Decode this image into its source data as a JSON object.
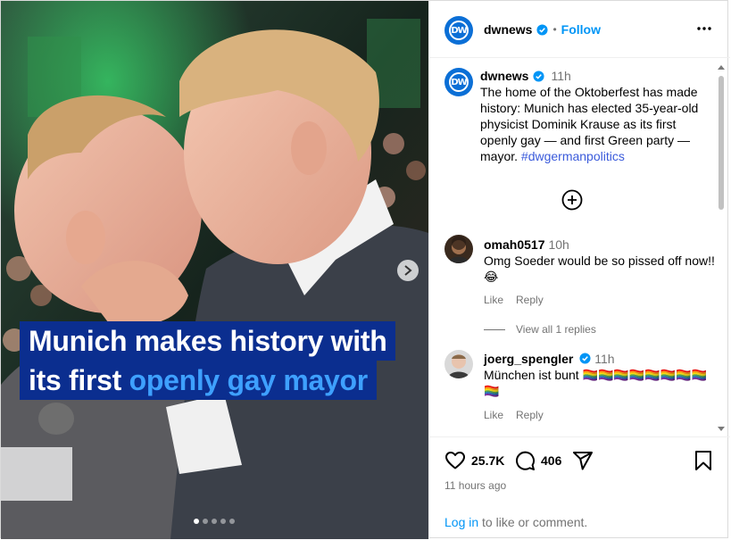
{
  "post": {
    "account": "dwnews",
    "follow_label": "Follow",
    "separator": "•",
    "media": {
      "headline_line1": "Munich makes history with",
      "headline_line2_prefix": "its first",
      "headline_line2_accent": "openly gay mayor",
      "slide_count": 5,
      "active_slide": 1
    },
    "caption": {
      "username": "dwnews",
      "time": "11h",
      "text": "The home of the Oktoberfest has made history: Munich has elected 35-year-old physicist Dominik Krause as its first openly gay — and first Green party — mayor.",
      "hashtag": "#dwgermanpolitics"
    },
    "comments": [
      {
        "username": "omah0517",
        "time": "10h",
        "text": "Omg Soeder would be so pissed off now!! 😂",
        "like_label": "Like",
        "reply_label": "Reply",
        "view_replies": "View all 1 replies"
      },
      {
        "username": "joerg_spengler",
        "time": "11h",
        "text": "München ist bunt 🏳️‍🌈🏳️‍🌈🏳️‍🌈🏳️‍🌈🏳️‍🌈🏳️‍🌈🏳️‍🌈🏳️‍🌈🏳️‍🌈",
        "like_label": "Like",
        "reply_label": "Reply"
      }
    ],
    "actions": {
      "likes": "25.7K",
      "comments": "406"
    },
    "posted_ago": "11 hours ago",
    "login_link": "Log in",
    "login_suffix": " to like or comment."
  },
  "colors": {
    "brand_blue": "#0095f6",
    "headline_bg": "#0b2e8f",
    "headline_accent": "#3ea0ff",
    "dw_logo": "#0b6fd6"
  },
  "icons": [
    "dw-logo-icon",
    "verified-badge-icon",
    "more-options-icon",
    "add-comment-plus-icon",
    "next-slide-icon",
    "heart-icon",
    "comment-bubble-icon",
    "share-send-icon",
    "bookmark-icon"
  ]
}
